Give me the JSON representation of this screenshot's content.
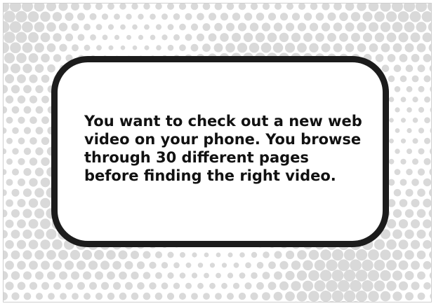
{
  "card": {
    "lines": [
      "You want to check out a new web",
      "video on your phone. You browse",
      "through 30 different pages",
      "before finding the right video."
    ]
  },
  "colors": {
    "background": "#ffffff",
    "dots": "#d9d9d9",
    "card_border": "#1c1c1c",
    "text": "#111111"
  }
}
